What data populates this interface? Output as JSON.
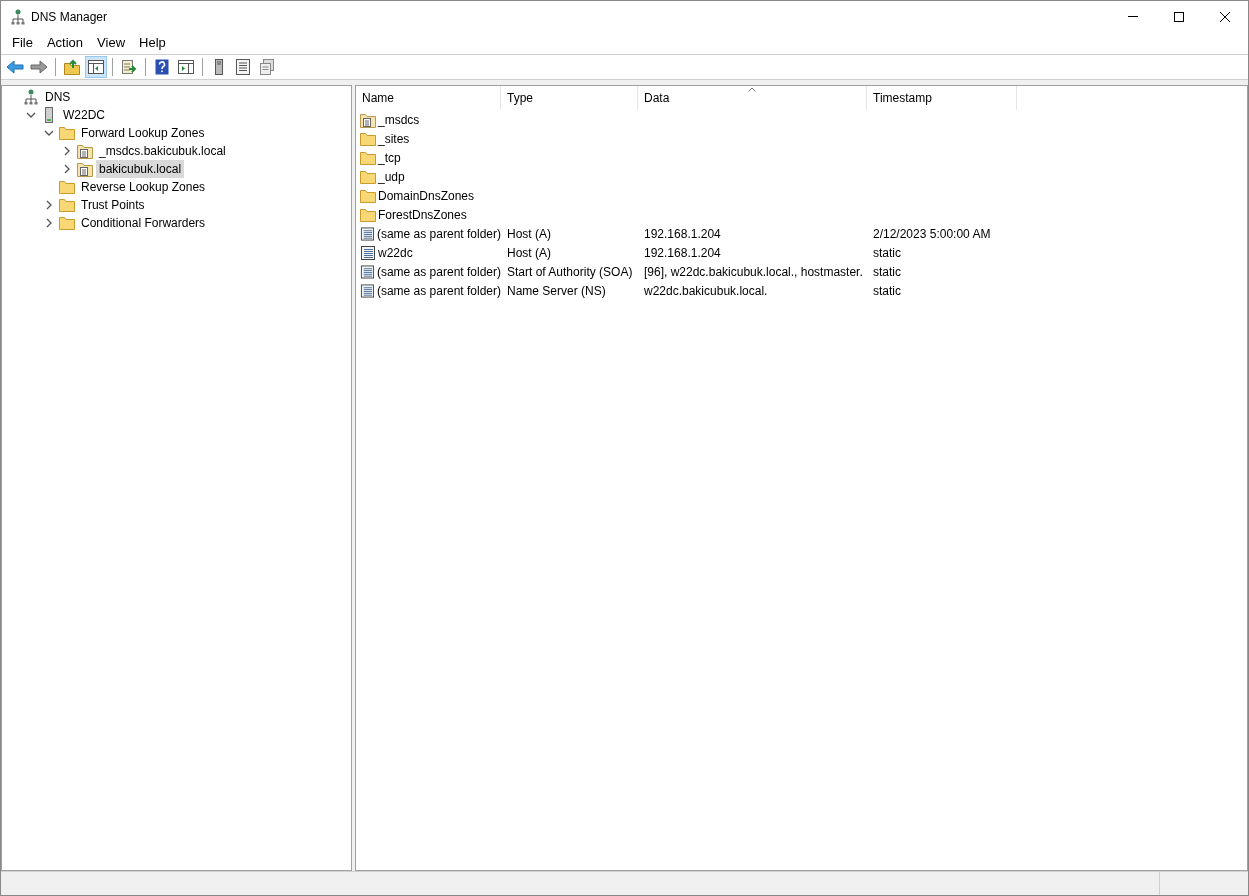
{
  "window": {
    "title": "DNS Manager"
  },
  "menu": [
    "File",
    "Action",
    "View",
    "Help"
  ],
  "toolbar": [
    [
      {
        "kind": "back",
        "pressed": false
      },
      {
        "kind": "forward",
        "pressed": false
      }
    ],
    [
      {
        "kind": "up",
        "pressed": false
      },
      {
        "kind": "tree",
        "pressed": true
      }
    ],
    [
      {
        "kind": "export",
        "pressed": false
      }
    ],
    [
      {
        "kind": "help",
        "pressed": false
      },
      {
        "kind": "panel",
        "pressed": false
      }
    ],
    [
      {
        "kind": "server",
        "pressed": false
      },
      {
        "kind": "list",
        "pressed": false
      },
      {
        "kind": "copy",
        "pressed": false
      }
    ]
  ],
  "tree": [
    {
      "label": "DNS",
      "kind": "dns",
      "selected": false,
      "children": [
        {
          "label": "W22DC",
          "kind": "server",
          "expanded": true,
          "selected": false,
          "children": [
            {
              "label": "Forward Lookup Zones",
              "kind": "folder",
              "expanded": true,
              "selected": false,
              "children": [
                {
                  "label": "_msdcs.bakicubuk.local",
                  "kind": "zone",
                  "expanded": false,
                  "selected": false
                },
                {
                  "label": "bakicubuk.local",
                  "kind": "zone",
                  "expanded": false,
                  "selected": true
                }
              ]
            },
            {
              "label": "Reverse Lookup Zones",
              "kind": "folder",
              "selected": false
            },
            {
              "label": "Trust Points",
              "kind": "folder",
              "expanded": false,
              "selected": false
            },
            {
              "label": "Conditional Forwarders",
              "kind": "folder",
              "expanded": false,
              "selected": false
            }
          ]
        }
      ]
    }
  ],
  "table": {
    "columns": [
      {
        "label": "Name",
        "sorted": false
      },
      {
        "label": "Type",
        "sorted": false
      },
      {
        "label": "Data",
        "sorted": true
      },
      {
        "label": "Timestamp",
        "sorted": false
      }
    ],
    "rows": [
      {
        "kind": "zone",
        "cells": [
          "_msdcs"
        ]
      },
      {
        "kind": "folder",
        "cells": [
          "_sites"
        ]
      },
      {
        "kind": "folder",
        "cells": [
          "_tcp"
        ]
      },
      {
        "kind": "folder",
        "cells": [
          "_udp"
        ]
      },
      {
        "kind": "folder",
        "cells": [
          "DomainDnsZones"
        ]
      },
      {
        "kind": "folder",
        "cells": [
          "ForestDnsZones"
        ]
      },
      {
        "kind": "record",
        "cells": [
          "(same as parent folder)",
          "Host (A)",
          "192.168.1.204",
          "2/12/2023 5:00:00 AM"
        ]
      },
      {
        "kind": "record",
        "cells": [
          "w22dc",
          "Host (A)",
          "192.168.1.204",
          "static"
        ]
      },
      {
        "kind": "record",
        "cells": [
          "(same as parent folder)",
          "Start of Authority (SOA)",
          "[96], w22dc.bakicubuk.local., hostmaster.",
          "static"
        ]
      },
      {
        "kind": "record",
        "cells": [
          "(same as parent folder)",
          "Name Server (NS)",
          "w22dc.bakicubuk.local.",
          "static"
        ]
      }
    ]
  }
}
